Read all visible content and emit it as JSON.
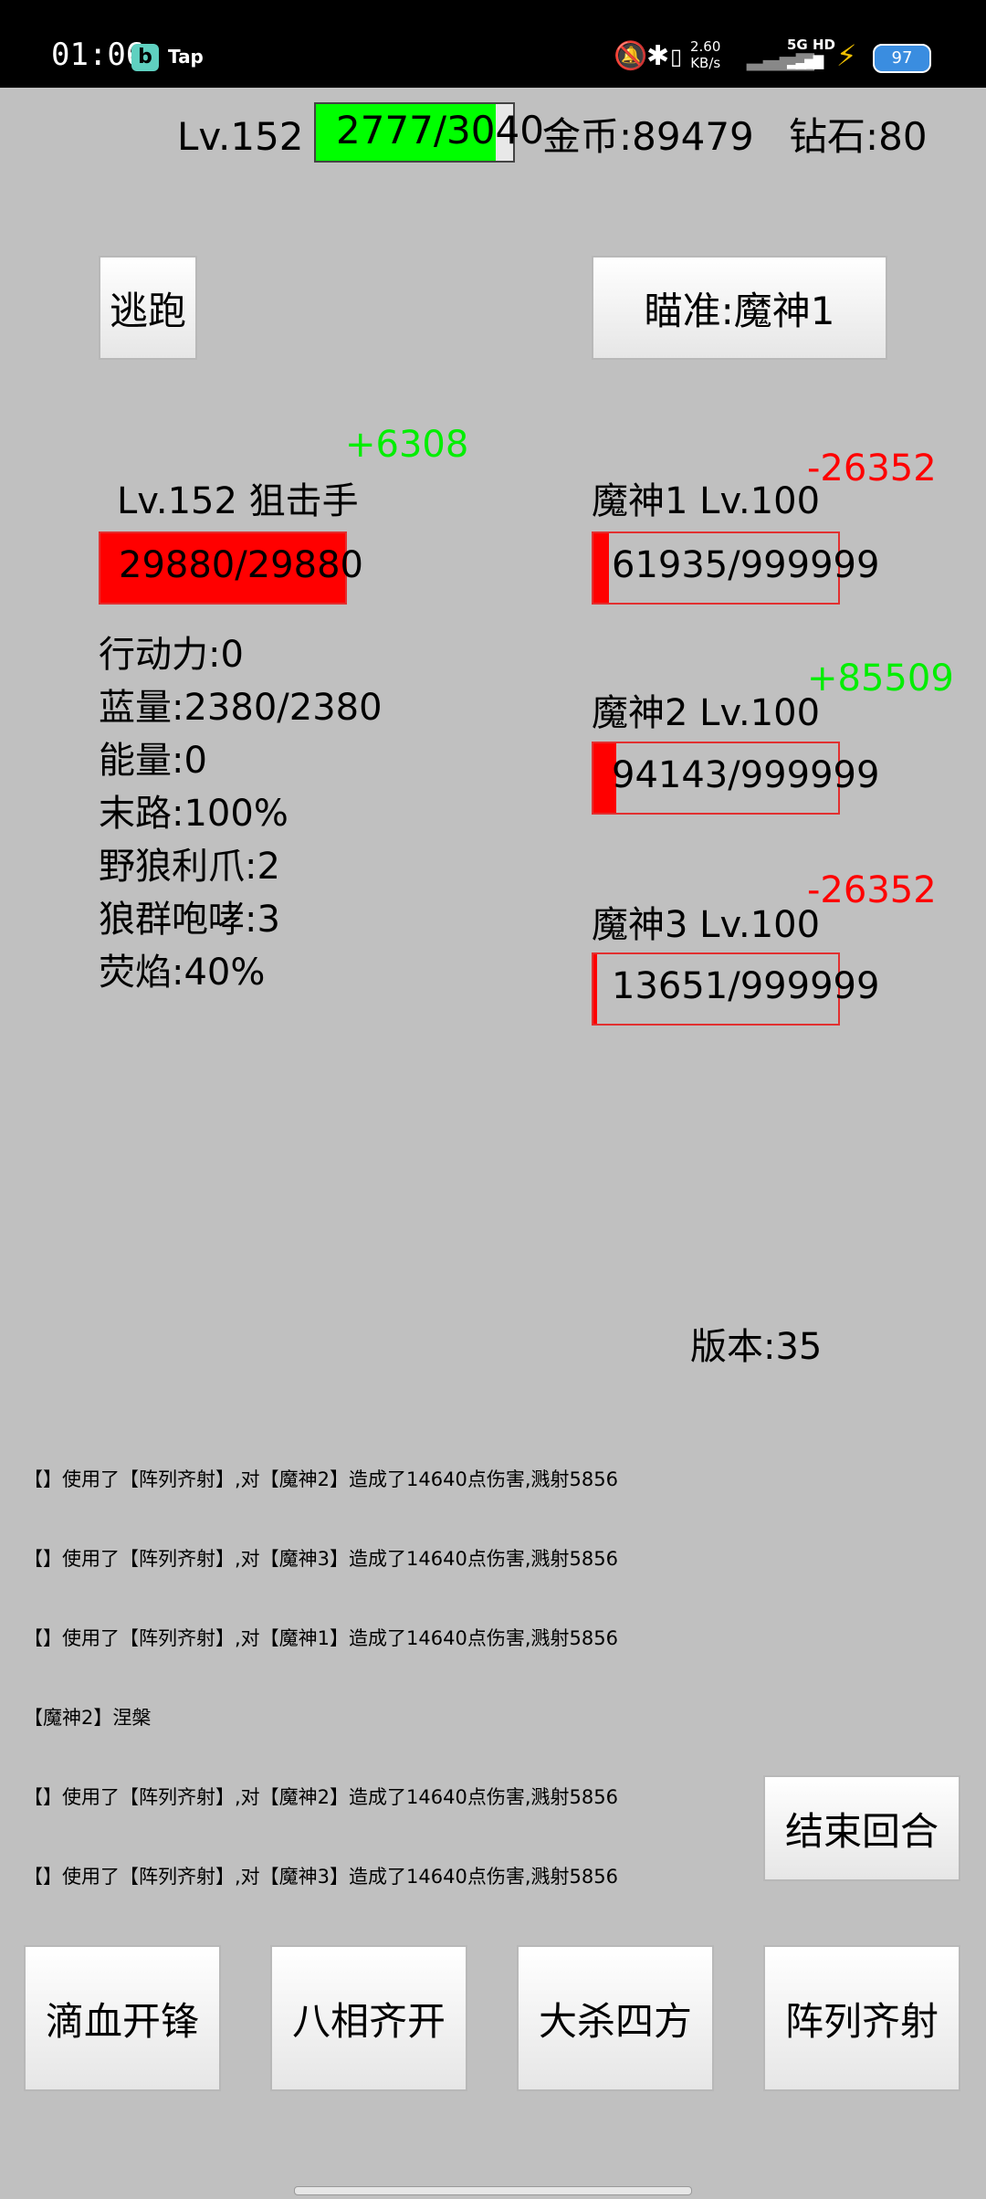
{
  "status_bar": {
    "time": "01:06",
    "app1": "b",
    "app2": "Tap",
    "icons": [
      "bell-off-icon",
      "bluetooth-icon",
      "vibrate-icon"
    ],
    "speed_value": "2.60",
    "speed_unit": "KB/s",
    "network": "5G HD",
    "battery": "97"
  },
  "player_header": {
    "level": "Lv.152",
    "exp": "2777/3040",
    "exp_fraction": 0.91,
    "gold": "金币:89479",
    "diamond": "钻石:80"
  },
  "actions": {
    "flee": "逃跑",
    "target": "瞄准:魔神1"
  },
  "player": {
    "heal_popup": "+6308",
    "title": "Lv.152  狙击手",
    "hp": "29880/29880",
    "hp_fraction": 1.0,
    "stats": [
      "行动力:0",
      "蓝量:2380/2380",
      "能量:0",
      "末路:100%",
      "野狼利爪:2",
      "狼群咆哮:3",
      "荧焰:40%"
    ]
  },
  "enemies": [
    {
      "name": "魔神1  Lv.100",
      "hp": "61935/999999",
      "hp_fraction": 0.062,
      "popup": "-26352",
      "popup_color": "#ff0000"
    },
    {
      "name": "魔神2  Lv.100",
      "hp": "94143/999999",
      "hp_fraction": 0.094,
      "popup": "+85509",
      "popup_color": "#00ee00"
    },
    {
      "name": "魔神3  Lv.100",
      "hp": "13651/999999",
      "hp_fraction": 0.014,
      "popup": "-26352",
      "popup_color": "#ff0000"
    }
  ],
  "version": "版本:35",
  "battle_log": [
    "【】使用了【阵列齐射】,对【魔神2】造成了14640点伤害,溅射5856",
    "【】使用了【阵列齐射】,对【魔神3】造成了14640点伤害,溅射5856",
    "【】使用了【阵列齐射】,对【魔神1】造成了14640点伤害,溅射5856",
    "【魔神2】涅槃",
    "【】使用了【阵列齐射】,对【魔神2】造成了14640点伤害,溅射5856",
    "【】使用了【阵列齐射】,对【魔神3】造成了14640点伤害,溅射5856"
  ],
  "end_turn": "结束回合",
  "skills": [
    "滴血开锋",
    "八相齐开",
    "大杀四方",
    "阵列齐射"
  ]
}
